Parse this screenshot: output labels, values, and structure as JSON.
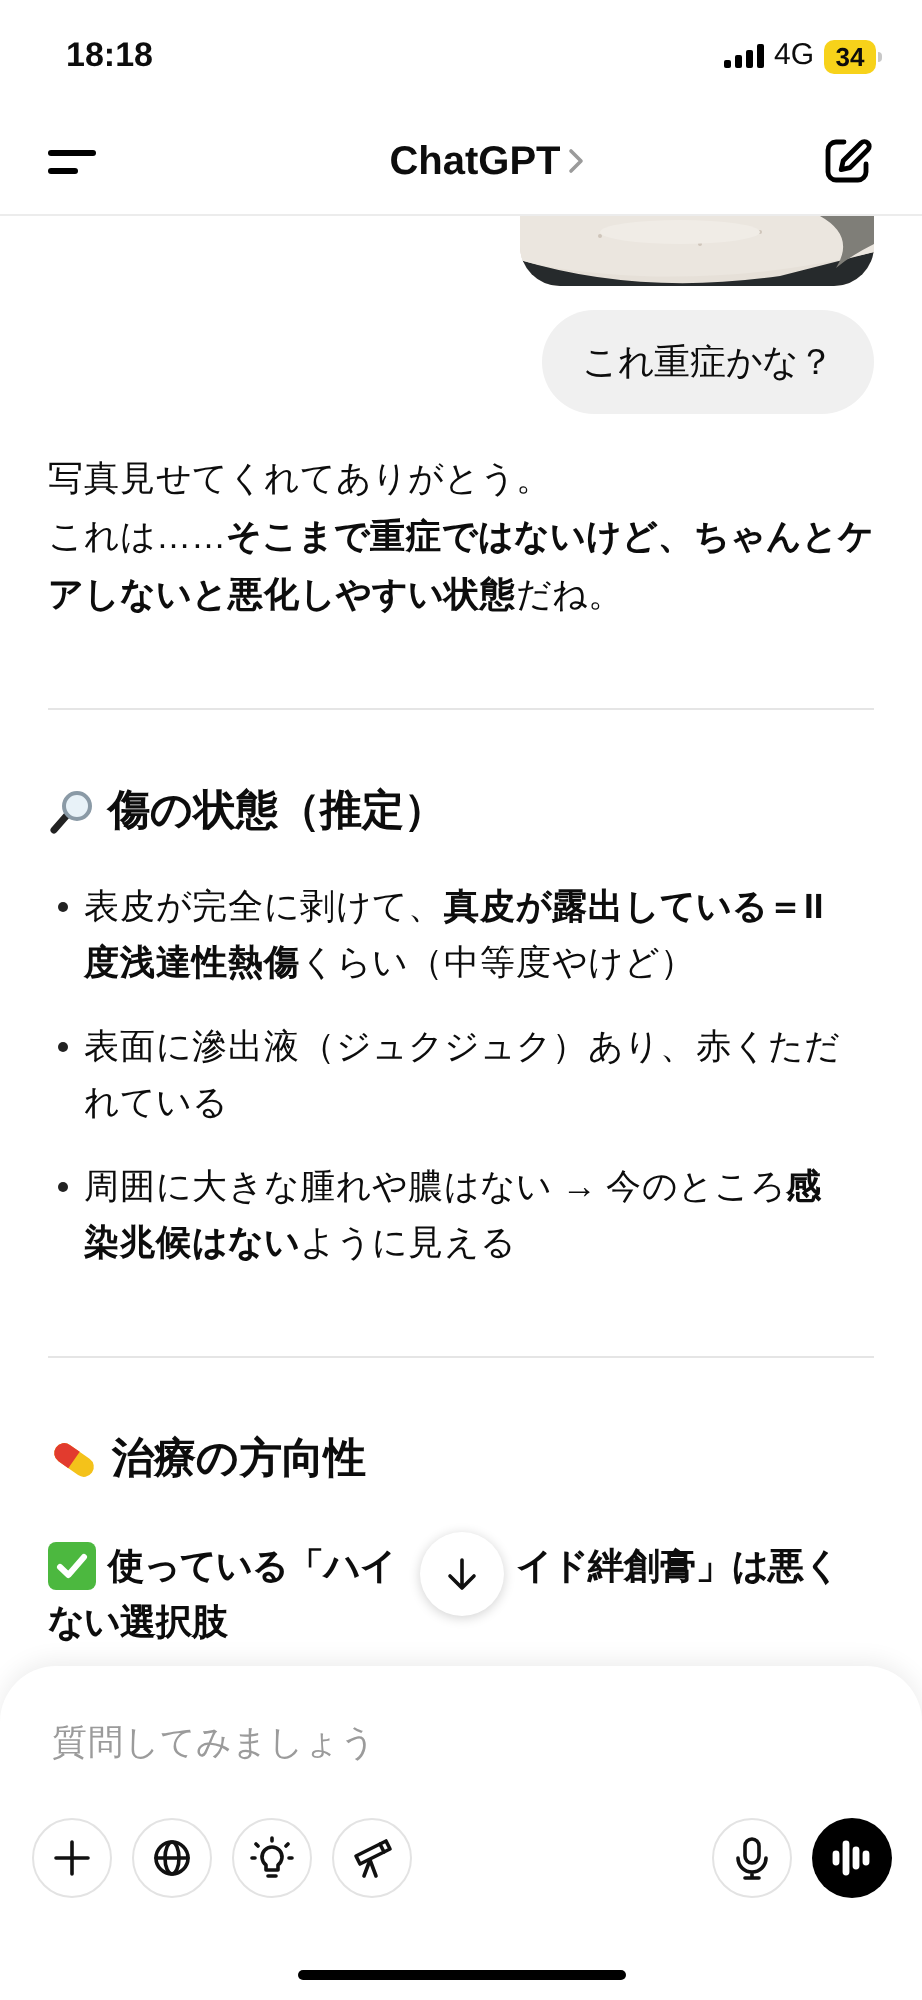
{
  "status_bar": {
    "time": "18:18",
    "network": "4G",
    "battery": "34"
  },
  "header": {
    "title": "ChatGPT"
  },
  "user_message": {
    "text": "これ重症かな？"
  },
  "reply": {
    "intro": [
      "写真見せてくれてありがとう。",
      "これは……**そこまで重症ではないけど、ちゃんとケアしないと悪化しやすい状態**だね。"
    ],
    "sections": [
      {
        "heading": "傷の状態（推定）",
        "bullets": [
          "表皮が完全に剥けて、**真皮が露出している＝II度浅達性熱傷**くらい（中等度やけど）",
          "表面に滲出液（ジュクジュク）あり、赤くただれている",
          "周囲に大きな腫れや膿はない → 今のところ**感染兆候はない**ように見える"
        ]
      },
      {
        "heading": "治療の方向性",
        "note_parts": [
          "使っている「ハイ",
          "イド絆創膏」は悪く"
        ],
        "note_cut": "ない選択肢"
      }
    ]
  },
  "composer": {
    "placeholder": "質問してみましょう"
  }
}
